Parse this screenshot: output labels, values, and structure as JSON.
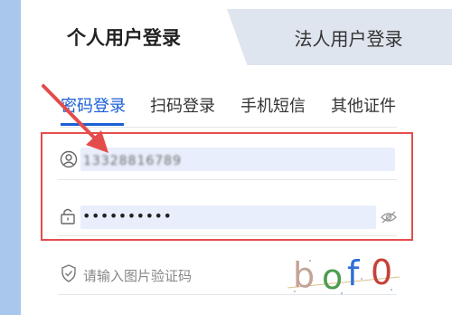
{
  "tabs": {
    "personal_login": "个人用户登录",
    "legal_login": "法人用户登录"
  },
  "subtabs": [
    {
      "label": "密码登录",
      "active": true
    },
    {
      "label": "扫码登录",
      "active": false
    },
    {
      "label": "手机短信",
      "active": false
    },
    {
      "label": "其他证件",
      "active": false
    }
  ],
  "form": {
    "username_value": "13328816789",
    "password_value": "••••••••••",
    "captcha_placeholder": "请输入图片验证码",
    "captcha_chars": [
      "b",
      "o",
      "f",
      "0"
    ]
  },
  "colors": {
    "accent": "#1a5fd6",
    "annotation": "#e44c4c",
    "input_bg": "#e8eefb"
  }
}
